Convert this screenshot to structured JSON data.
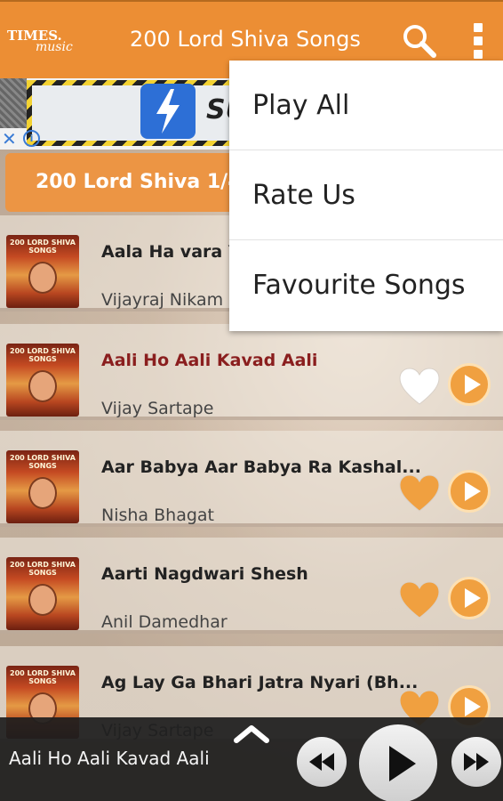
{
  "appbar": {
    "logo_line1": "TIMES",
    "logo_line2": "music",
    "title": "200 Lord Shiva Songs",
    "search_icon": "search-icon",
    "overflow_icon": "more-vertical-icon"
  },
  "ad": {
    "brand_text": "SU",
    "close_icon": "close-icon",
    "info_icon": "info-icon"
  },
  "album": {
    "title": "200 Lord Shiva 1/4"
  },
  "thumb_caption": "200 LORD SHIVA SONGS",
  "songs": [
    {
      "title": "Aala Ha vara Ye",
      "artist": "Vijayraj Nikam",
      "favourite": false
    },
    {
      "title": "Aali Ho Aali Kavad Aali",
      "artist": "Vijay Sartape",
      "favourite": false,
      "active": true
    },
    {
      "title": "Aar Babya Aar Babya Ra Kashal...",
      "artist": "Nisha Bhagat",
      "favourite": true
    },
    {
      "title": "Aarti Nagdwari Shesh",
      "artist": "Anil Damedhar",
      "favourite": true
    },
    {
      "title": "Ag Lay Ga Bhari Jatra Nyari (Bh...",
      "artist": "Vijay Sartape",
      "favourite": true
    }
  ],
  "menu": {
    "items": [
      "Play All",
      "Rate Us",
      "Favourite Songs"
    ]
  },
  "player": {
    "now_playing": "Aali Ho Aali Kavad Aali",
    "expand_icon": "chevron-up-icon",
    "prev_icon": "rewind-icon",
    "play_icon": "play-icon",
    "next_icon": "fast-forward-icon"
  },
  "colors": {
    "accent": "#ec8e34",
    "active_title": "#8a1e1e",
    "heart_fav": "#f0a040",
    "heart_nonfav": "#ffffff"
  }
}
